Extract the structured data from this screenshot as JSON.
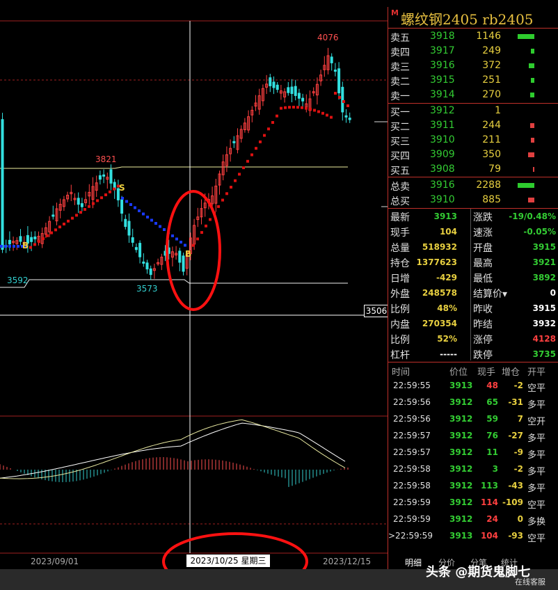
{
  "instrument": {
    "marker": "M",
    "title": "螺纹钢2405  rb2405"
  },
  "asks": [
    {
      "label": "卖五",
      "price": "3918",
      "vol": "1146",
      "bar": 1.0
    },
    {
      "label": "卖四",
      "price": "3917",
      "vol": "249",
      "bar": 0.22
    },
    {
      "label": "卖三",
      "price": "3916",
      "vol": "372",
      "bar": 0.32
    },
    {
      "label": "卖二",
      "price": "3915",
      "vol": "251",
      "bar": 0.22
    },
    {
      "label": "卖一",
      "price": "3914",
      "vol": "270",
      "bar": 0.24
    }
  ],
  "bids": [
    {
      "label": "买一",
      "price": "3912",
      "vol": "1",
      "bar": 0.0
    },
    {
      "label": "买二",
      "price": "3911",
      "vol": "244",
      "bar": 0.25
    },
    {
      "label": "买三",
      "price": "3910",
      "vol": "211",
      "bar": 0.22
    },
    {
      "label": "买四",
      "price": "3909",
      "vol": "350",
      "bar": 0.37
    },
    {
      "label": "买五",
      "price": "3908",
      "vol": "79",
      "bar": 0.08
    }
  ],
  "totals": [
    {
      "label": "总卖",
      "price": "3916",
      "vol": "2288",
      "bar": 1.0,
      "color": "#2ecc2e"
    },
    {
      "label": "总买",
      "price": "3910",
      "vol": "885",
      "bar": 0.39,
      "color": "#e04040"
    }
  ],
  "stats": [
    {
      "k1": "最新",
      "v1": "3913",
      "c1": "green",
      "k2": "涨跌",
      "v2": "-19/0.48%",
      "c2": "green"
    },
    {
      "k1": "现手",
      "v1": "104",
      "c1": "yellow",
      "k2": "速涨",
      "v2": "-0.05%",
      "c2": "green"
    },
    {
      "k1": "总量",
      "v1": "518932",
      "c1": "yellow",
      "k2": "开盘",
      "v2": "3915",
      "c2": "green"
    },
    {
      "k1": "持仓",
      "v1": "1377623",
      "c1": "yellow",
      "k2": "最高",
      "v2": "3921",
      "c2": "green"
    },
    {
      "k1": "日增",
      "v1": "-429",
      "c1": "yellow",
      "k2": "最低",
      "v2": "3892",
      "c2": "green"
    },
    {
      "k1": "外盘",
      "v1": "248578",
      "c1": "yellow",
      "k2": "结算价▾",
      "v2": "0",
      "c2": "white"
    },
    {
      "k1": "比例",
      "v1": "48%",
      "c1": "yellow",
      "k2": "昨收",
      "v2": "3915",
      "c2": "white"
    },
    {
      "k1": "内盘",
      "v1": "270354",
      "c1": "yellow",
      "k2": "昨结",
      "v2": "3932",
      "c2": "white"
    },
    {
      "k1": "比例",
      "v1": "52%",
      "c1": "yellow",
      "k2": "涨停",
      "v2": "4128",
      "c2": "red"
    },
    {
      "k1": "杠杆",
      "v1": "-----",
      "c1": "white",
      "k2": "跌停",
      "v2": "3735",
      "c2": "green"
    }
  ],
  "trades_header": {
    "time": "时间",
    "price": "价位",
    "hand": "现手",
    "inc": "增仓",
    "type": "开平"
  },
  "trades": [
    {
      "time": "22:59:55",
      "price": "3913",
      "hand": "48",
      "inc": "-2",
      "type": "空平",
      "hc": "red"
    },
    {
      "time": "22:59:56",
      "price": "3912",
      "hand": "65",
      "inc": "-31",
      "type": "多平",
      "hc": "green"
    },
    {
      "time": "22:59:56",
      "price": "3912",
      "hand": "59",
      "inc": "7",
      "type": "空开",
      "hc": "green"
    },
    {
      "time": "22:59:57",
      "price": "3912",
      "hand": "76",
      "inc": "-27",
      "type": "多平",
      "hc": "green"
    },
    {
      "time": "22:59:57",
      "price": "3912",
      "hand": "11",
      "inc": "-9",
      "type": "多平",
      "hc": "green"
    },
    {
      "time": "22:59:58",
      "price": "3912",
      "hand": "3",
      "inc": "-2",
      "type": "多平",
      "hc": "green"
    },
    {
      "time": "22:59:58",
      "price": "3912",
      "hand": "113",
      "inc": "-43",
      "type": "多平",
      "hc": "green"
    },
    {
      "time": "22:59:59",
      "price": "3912",
      "hand": "114",
      "inc": "-109",
      "type": "空平",
      "hc": "red"
    },
    {
      "time": "22:59:59",
      "price": "3912",
      "hand": "24",
      "inc": "0",
      "type": "多换",
      "hc": "red"
    },
    {
      "time": ">22:59:59",
      "price": "3913",
      "hand": "104",
      "inc": "-93",
      "type": "空平",
      "hc": "red"
    }
  ],
  "tabs": [
    "明细",
    "分价",
    "分笔",
    "统计"
  ],
  "chart": {
    "price_labels": {
      "high": "4076",
      "mid": "3821",
      "low1": "3592",
      "low2": "3573"
    },
    "cursor_price": "3506",
    "signals": [
      "B",
      "S",
      "B"
    ],
    "dates": {
      "left": "2023/09/01",
      "cursor": "2023/10/25 星期三",
      "right": "2023/12/15"
    }
  },
  "watermark": "头条 @期货鬼脚七",
  "service": "在线客服",
  "colors": {
    "up": "#ff4040",
    "down": "#33e0e0",
    "sar_up": "#dd1111",
    "sar_down": "#1a3aff",
    "circle": "#ff1111"
  }
}
